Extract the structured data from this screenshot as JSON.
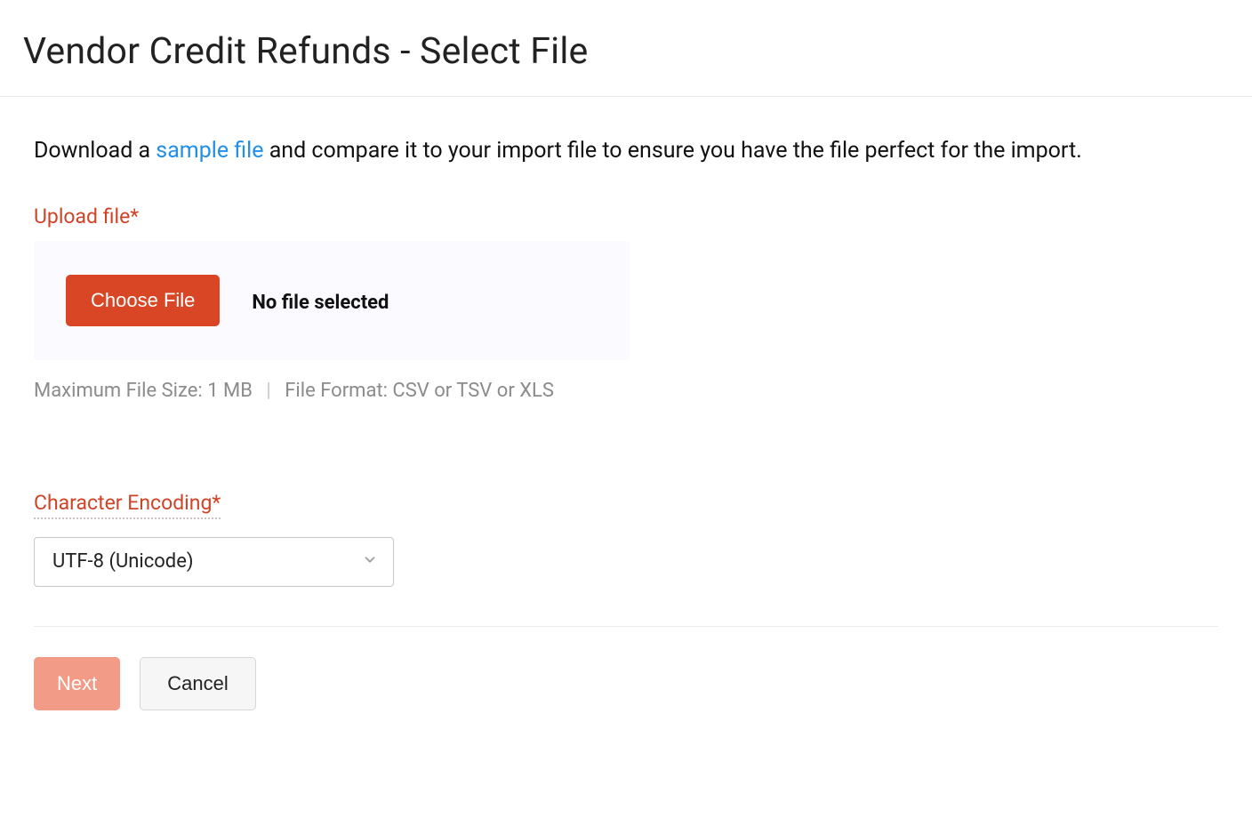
{
  "header": {
    "title": "Vendor Credit Refunds - Select File"
  },
  "intro": {
    "prefix": "Download a ",
    "link": "sample file",
    "suffix": " and compare it to your import file to ensure you have the file perfect for the import."
  },
  "upload": {
    "label": "Upload file",
    "asterisk": "*",
    "choose_button": "Choose File",
    "no_file_text": "No file selected",
    "hint_size": "Maximum File Size: 1 MB",
    "hint_divider": "|",
    "hint_format": "File Format: CSV or TSV or XLS"
  },
  "encoding": {
    "label": "Character Encoding",
    "asterisk": "*",
    "selected": "UTF-8 (Unicode)"
  },
  "footer": {
    "next": "Next",
    "cancel": "Cancel"
  }
}
